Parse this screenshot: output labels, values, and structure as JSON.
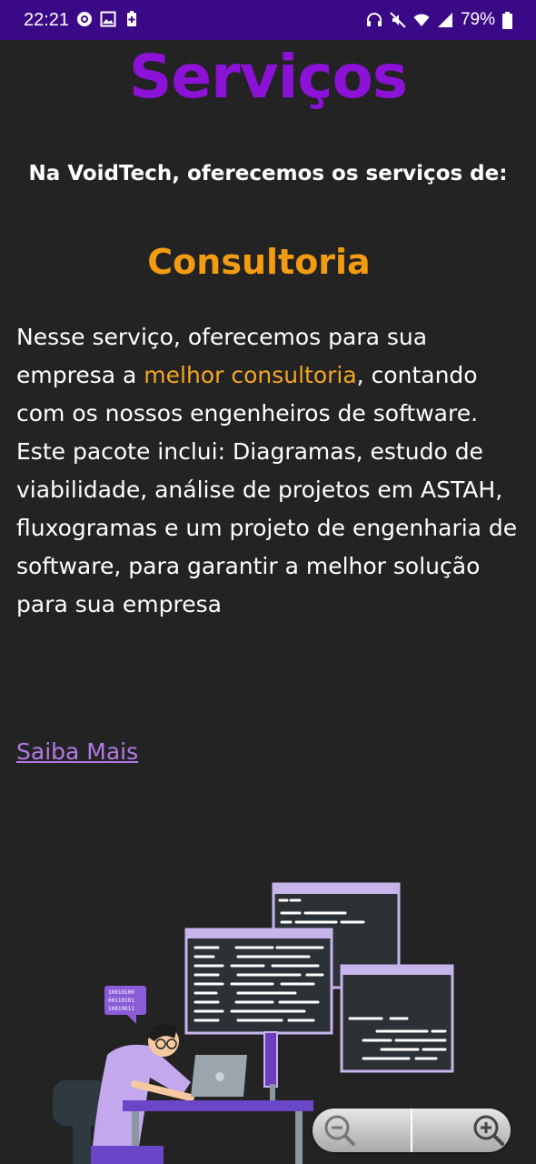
{
  "status_bar": {
    "time": "22:21",
    "left_icons": [
      "record-icon",
      "image-icon",
      "battery-saver-icon"
    ],
    "right_icons": [
      "headset-icon",
      "mute-icon",
      "wifi-icon",
      "signal-icon"
    ],
    "battery": "79%"
  },
  "page": {
    "title": "Serviços",
    "subtitle": "Na VoidTech, oferecemos os serviços de:",
    "section": {
      "title": "Consultoria",
      "text_before": "Nesse serviço, oferecemos para sua empresa a ",
      "highlight": "melhor consultoria",
      "text_after": ", contando com os nossos engenheiros de software. Este pacote inclui: Diagramas, estudo de viabilidade, análise de projetos em ASTAH, fluxogramas e um projeto de engenharia de software, para garantir a melhor solução para sua empresa",
      "link": "Saiba Mais"
    }
  },
  "illustration": {
    "bubble_lines": [
      "10010100",
      "00110101",
      "10010011"
    ]
  },
  "colors": {
    "status_bar": "#3a0a86",
    "background": "#232323",
    "title": "#8b12d6",
    "section_title": "#f39c12",
    "highlight": "#f5a623",
    "link": "#b37ae6"
  }
}
